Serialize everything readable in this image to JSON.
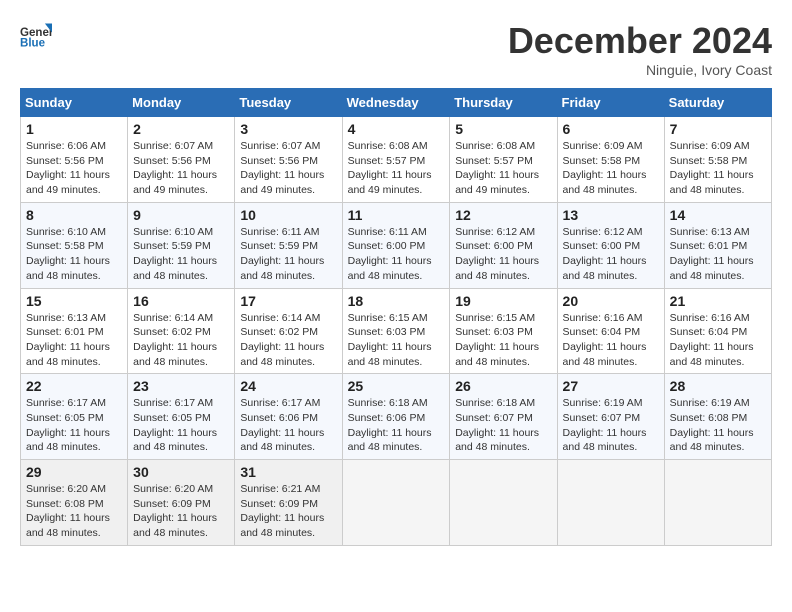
{
  "header": {
    "logo_line1": "General",
    "logo_line2": "Blue",
    "month_title": "December 2024",
    "subtitle": "Ninguie, Ivory Coast"
  },
  "weekdays": [
    "Sunday",
    "Monday",
    "Tuesday",
    "Wednesday",
    "Thursday",
    "Friday",
    "Saturday"
  ],
  "weeks": [
    [
      {
        "day": "1",
        "sunrise": "6:06 AM",
        "sunset": "5:56 PM",
        "daylight": "11 hours and 49 minutes."
      },
      {
        "day": "2",
        "sunrise": "6:07 AM",
        "sunset": "5:56 PM",
        "daylight": "11 hours and 49 minutes."
      },
      {
        "day": "3",
        "sunrise": "6:07 AM",
        "sunset": "5:56 PM",
        "daylight": "11 hours and 49 minutes."
      },
      {
        "day": "4",
        "sunrise": "6:08 AM",
        "sunset": "5:57 PM",
        "daylight": "11 hours and 49 minutes."
      },
      {
        "day": "5",
        "sunrise": "6:08 AM",
        "sunset": "5:57 PM",
        "daylight": "11 hours and 49 minutes."
      },
      {
        "day": "6",
        "sunrise": "6:09 AM",
        "sunset": "5:58 PM",
        "daylight": "11 hours and 48 minutes."
      },
      {
        "day": "7",
        "sunrise": "6:09 AM",
        "sunset": "5:58 PM",
        "daylight": "11 hours and 48 minutes."
      }
    ],
    [
      {
        "day": "8",
        "sunrise": "6:10 AM",
        "sunset": "5:58 PM",
        "daylight": "11 hours and 48 minutes."
      },
      {
        "day": "9",
        "sunrise": "6:10 AM",
        "sunset": "5:59 PM",
        "daylight": "11 hours and 48 minutes."
      },
      {
        "day": "10",
        "sunrise": "6:11 AM",
        "sunset": "5:59 PM",
        "daylight": "11 hours and 48 minutes."
      },
      {
        "day": "11",
        "sunrise": "6:11 AM",
        "sunset": "6:00 PM",
        "daylight": "11 hours and 48 minutes."
      },
      {
        "day": "12",
        "sunrise": "6:12 AM",
        "sunset": "6:00 PM",
        "daylight": "11 hours and 48 minutes."
      },
      {
        "day": "13",
        "sunrise": "6:12 AM",
        "sunset": "6:00 PM",
        "daylight": "11 hours and 48 minutes."
      },
      {
        "day": "14",
        "sunrise": "6:13 AM",
        "sunset": "6:01 PM",
        "daylight": "11 hours and 48 minutes."
      }
    ],
    [
      {
        "day": "15",
        "sunrise": "6:13 AM",
        "sunset": "6:01 PM",
        "daylight": "11 hours and 48 minutes."
      },
      {
        "day": "16",
        "sunrise": "6:14 AM",
        "sunset": "6:02 PM",
        "daylight": "11 hours and 48 minutes."
      },
      {
        "day": "17",
        "sunrise": "6:14 AM",
        "sunset": "6:02 PM",
        "daylight": "11 hours and 48 minutes."
      },
      {
        "day": "18",
        "sunrise": "6:15 AM",
        "sunset": "6:03 PM",
        "daylight": "11 hours and 48 minutes."
      },
      {
        "day": "19",
        "sunrise": "6:15 AM",
        "sunset": "6:03 PM",
        "daylight": "11 hours and 48 minutes."
      },
      {
        "day": "20",
        "sunrise": "6:16 AM",
        "sunset": "6:04 PM",
        "daylight": "11 hours and 48 minutes."
      },
      {
        "day": "21",
        "sunrise": "6:16 AM",
        "sunset": "6:04 PM",
        "daylight": "11 hours and 48 minutes."
      }
    ],
    [
      {
        "day": "22",
        "sunrise": "6:17 AM",
        "sunset": "6:05 PM",
        "daylight": "11 hours and 48 minutes."
      },
      {
        "day": "23",
        "sunrise": "6:17 AM",
        "sunset": "6:05 PM",
        "daylight": "11 hours and 48 minutes."
      },
      {
        "day": "24",
        "sunrise": "6:17 AM",
        "sunset": "6:06 PM",
        "daylight": "11 hours and 48 minutes."
      },
      {
        "day": "25",
        "sunrise": "6:18 AM",
        "sunset": "6:06 PM",
        "daylight": "11 hours and 48 minutes."
      },
      {
        "day": "26",
        "sunrise": "6:18 AM",
        "sunset": "6:07 PM",
        "daylight": "11 hours and 48 minutes."
      },
      {
        "day": "27",
        "sunrise": "6:19 AM",
        "sunset": "6:07 PM",
        "daylight": "11 hours and 48 minutes."
      },
      {
        "day": "28",
        "sunrise": "6:19 AM",
        "sunset": "6:08 PM",
        "daylight": "11 hours and 48 minutes."
      }
    ],
    [
      {
        "day": "29",
        "sunrise": "6:20 AM",
        "sunset": "6:08 PM",
        "daylight": "11 hours and 48 minutes."
      },
      {
        "day": "30",
        "sunrise": "6:20 AM",
        "sunset": "6:09 PM",
        "daylight": "11 hours and 48 minutes."
      },
      {
        "day": "31",
        "sunrise": "6:21 AM",
        "sunset": "6:09 PM",
        "daylight": "11 hours and 48 minutes."
      },
      null,
      null,
      null,
      null
    ]
  ]
}
